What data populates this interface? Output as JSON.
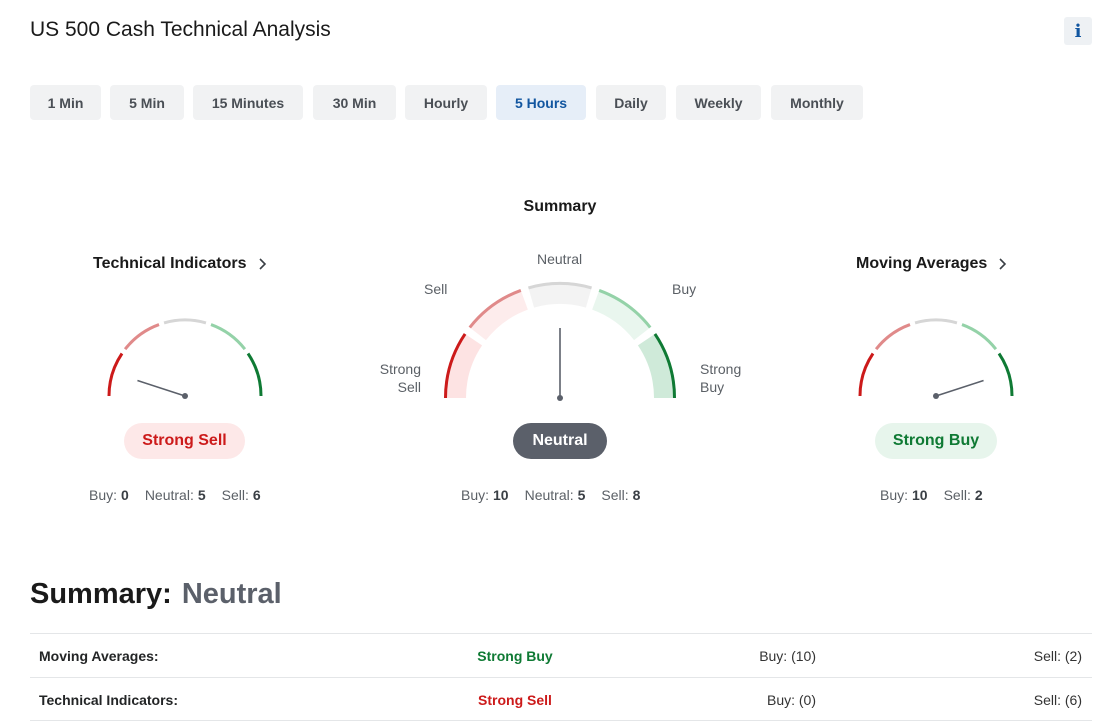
{
  "page_title": "US 500 Cash Technical Analysis",
  "info_icon": "info-icon",
  "timeframes": [
    {
      "label": "1 Min",
      "active": false
    },
    {
      "label": "5 Min",
      "active": false
    },
    {
      "label": "15 Minutes",
      "active": false
    },
    {
      "label": "30 Min",
      "active": false
    },
    {
      "label": "Hourly",
      "active": false
    },
    {
      "label": "5 Hours",
      "active": true
    },
    {
      "label": "Daily",
      "active": false
    },
    {
      "label": "Weekly",
      "active": false
    },
    {
      "label": "Monthly",
      "active": false
    }
  ],
  "summary_gauge": {
    "title": "Summary",
    "labels": {
      "strong_sell_1": "Strong",
      "strong_sell_2": "Sell",
      "sell": "Sell",
      "neutral": "Neutral",
      "buy": "Buy",
      "strong_buy_1": "Strong",
      "strong_buy_2": "Buy"
    },
    "needle_fraction": 0.5,
    "result": "Neutral",
    "buy_label": "Buy:",
    "buy": "10",
    "neutral_label": "Neutral:",
    "neutral": "5",
    "sell_label": "Sell:",
    "sell": "8"
  },
  "technical_indicators": {
    "title": "Technical Indicators",
    "needle_fraction": 0.1,
    "result": "Strong Sell",
    "buy_label": "Buy:",
    "buy": "0",
    "neutral_label": "Neutral:",
    "neutral": "5",
    "sell_label": "Sell:",
    "sell": "6"
  },
  "moving_averages": {
    "title": "Moving Averages",
    "needle_fraction": 0.9,
    "result": "Strong Buy",
    "buy_label": "Buy:",
    "buy": "10",
    "sell_label": "Sell:",
    "sell": "2"
  },
  "overall": {
    "label": "Summary:",
    "value": "Neutral"
  },
  "table": [
    {
      "name": "Moving Averages:",
      "status": "Strong Buy",
      "status_color": "green",
      "buy": "Buy: (10)",
      "sell": "Sell: (2)"
    },
    {
      "name": "Technical Indicators:",
      "status": "Strong Sell",
      "status_color": "red",
      "buy": "Buy: (0)",
      "sell": "Sell: (6)"
    }
  ],
  "colors": {
    "strong_sell": "#cc1a1a",
    "sell": "#e08a8a",
    "neutral": "#d6d6d6",
    "buy": "#94d2a8",
    "strong_buy": "#0f7a34",
    "accent": "#1256a0"
  }
}
